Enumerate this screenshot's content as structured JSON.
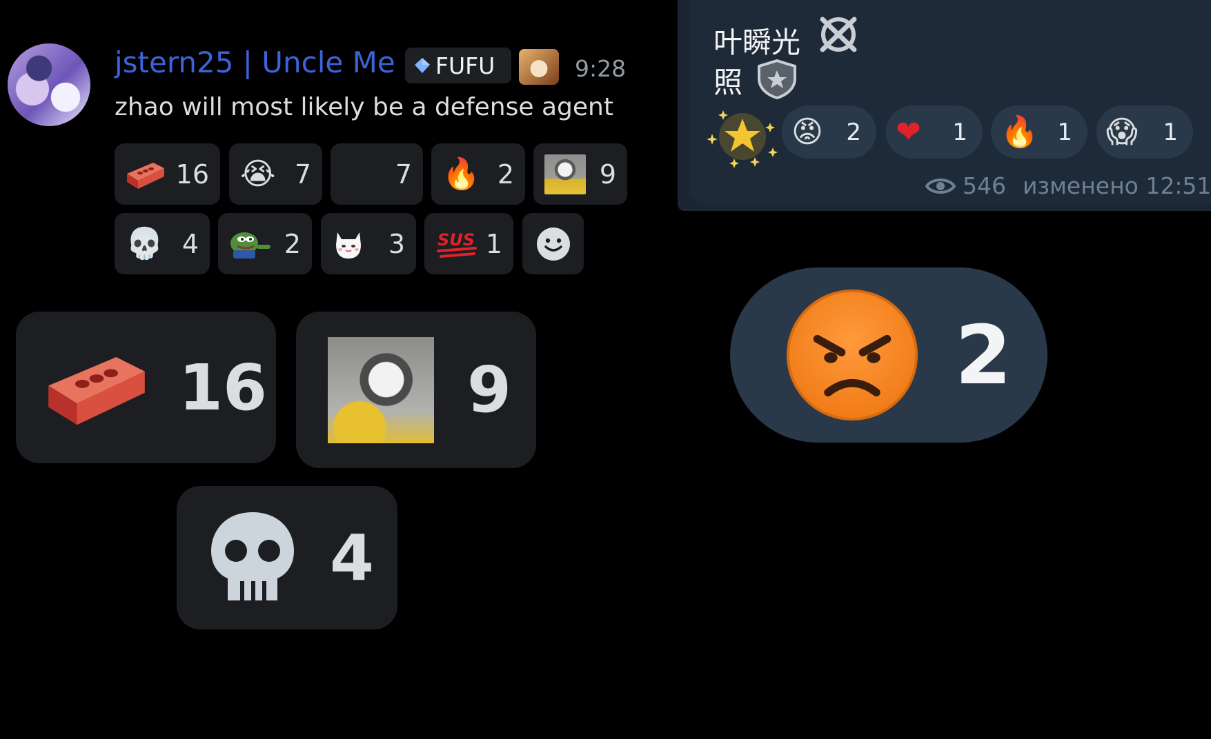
{
  "discord": {
    "username": "jstern25 | Uncle Me",
    "tag": "FUFU",
    "time": "9:28",
    "message": "zhao will most likely be a defense agent",
    "reactions_row1": [
      {
        "icon": "brick-icon",
        "count": "16"
      },
      {
        "icon": "loudly-crying-face-icon",
        "count": "7"
      },
      {
        "icon": "blank-emoji-icon",
        "count": "7"
      },
      {
        "icon": "fire-icon",
        "count": "2"
      },
      {
        "icon": "screaming-rooster-photo-icon",
        "count": "9"
      }
    ],
    "reactions_row2": [
      {
        "icon": "skull-icon",
        "count": "4"
      },
      {
        "icon": "pepe-frog-pointing-icon",
        "count": "2"
      },
      {
        "icon": "white-cat-icon",
        "count": "3"
      },
      {
        "icon": "sus-sticker-icon",
        "count": "1"
      },
      {
        "icon": "add-reaction-icon"
      }
    ],
    "zoomed": [
      {
        "icon": "brick-icon",
        "count": "16"
      },
      {
        "icon": "screaming-rooster-photo-icon",
        "count": "9"
      },
      {
        "icon": "skull-icon",
        "count": "4"
      }
    ]
  },
  "telegram": {
    "line1": "叶瞬光",
    "line2": "照",
    "reactions": [
      {
        "icon": "sparkle-star-icon"
      },
      {
        "icon": "angry-face-icon",
        "count": "2"
      },
      {
        "icon": "red-heart-icon",
        "count": "1"
      },
      {
        "icon": "fire-icon",
        "count": "1"
      },
      {
        "icon": "screaming-face-icon",
        "count": "1"
      }
    ],
    "views": "546",
    "edited": "изменено 12:51",
    "zoomed": {
      "icon": "angry-face-icon",
      "count": "2"
    }
  },
  "colors": {
    "username": "#3d63d8",
    "discord_chip": "#1d1e22",
    "telegram_bubble": "#1e2a38",
    "telegram_chip": "#2a3949"
  }
}
